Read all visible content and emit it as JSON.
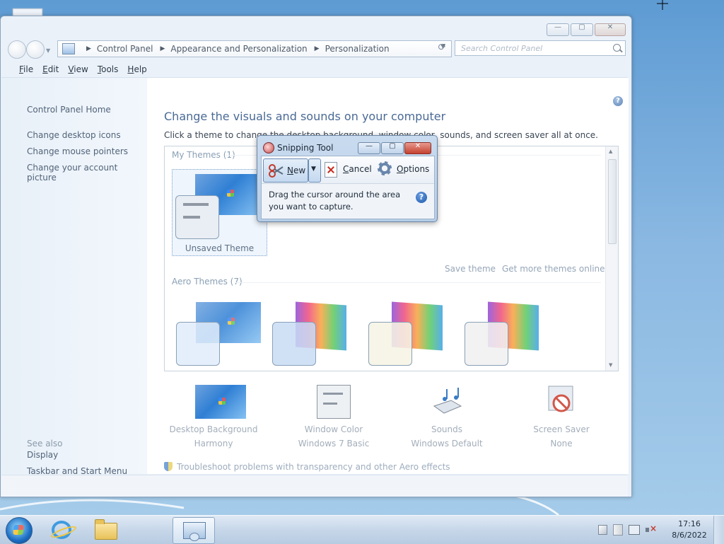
{
  "window": {
    "breadcrumbs": [
      "Control Panel",
      "Appearance and Personalization",
      "Personalization"
    ],
    "search_placeholder": "Search Control Panel"
  },
  "menubar": {
    "items": [
      {
        "mnemonic": "F",
        "rest": "ile"
      },
      {
        "mnemonic": "E",
        "rest": "dit"
      },
      {
        "mnemonic": "V",
        "rest": "iew"
      },
      {
        "mnemonic": "T",
        "rest": "ools"
      },
      {
        "mnemonic": "H",
        "rest": "elp"
      }
    ]
  },
  "left_pane": {
    "home": "Control Panel Home",
    "links": [
      "Change desktop icons",
      "Change mouse pointers",
      "Change your account picture"
    ],
    "see_also_label": "See also",
    "see_also": [
      "Display",
      "Taskbar and Start Menu"
    ]
  },
  "content": {
    "title": "Change the visuals and sounds on your computer",
    "subtitle": "Click a theme to change the desktop background, window color, sounds, and screen saver all at once.",
    "my_themes_label": "My Themes (1)",
    "unsaved_theme": "Unsaved Theme",
    "save_theme": "Save theme",
    "get_more": "Get more themes online",
    "aero_themes_label": "Aero Themes (7)",
    "tiles": [
      {
        "label": "Desktop Background",
        "value": "Harmony",
        "icon": "desktop-background-icon"
      },
      {
        "label": "Window Color",
        "value": "Windows 7 Basic",
        "icon": "window-color-icon"
      },
      {
        "label": "Sounds",
        "value": "Windows Default",
        "icon": "sounds-icon"
      },
      {
        "label": "Screen Saver",
        "value": "None",
        "icon": "screen-saver-icon"
      }
    ],
    "troubleshoot": "Troubleshoot problems with transparency and other Aero effects"
  },
  "snipping_tool": {
    "title": "Snipping Tool",
    "new_mnemonic": "N",
    "new_rest": "ew",
    "cancel_mnemonic": "C",
    "cancel_rest": "ancel",
    "options_mnemonic": "O",
    "options_rest": "ptions",
    "message_line1": "Drag the cursor around the area",
    "message_line2": "you want to capture."
  },
  "taskbar": {
    "time": "17:16",
    "date": "8/6/2022"
  }
}
